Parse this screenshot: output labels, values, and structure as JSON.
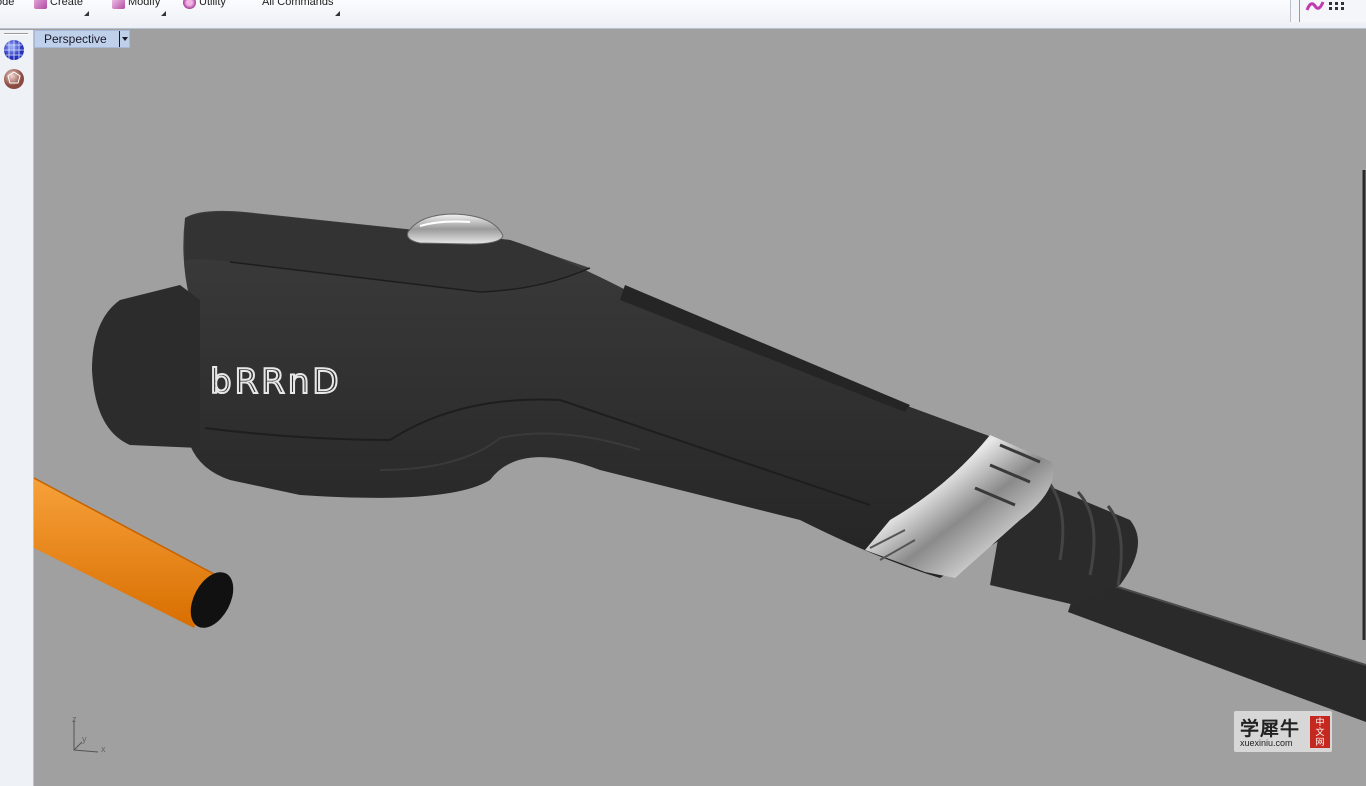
{
  "toolbar": {
    "items": [
      {
        "label": "ode"
      },
      {
        "label": "Create"
      },
      {
        "label": "Modify"
      },
      {
        "label": "Utility"
      },
      {
        "label": "All Commands"
      }
    ]
  },
  "viewport": {
    "title": "Perspective",
    "axes": {
      "z": "z",
      "y": "y",
      "x": "x"
    }
  },
  "model": {
    "brand_text": "bRRnD"
  },
  "colors": {
    "viewport_bg": "#a0a0a0",
    "handle_body": "#2f2f2f",
    "cable_orange": "#f08a12",
    "tab_bg": "#bfd0ea"
  },
  "watermark": {
    "chinese": "学犀牛",
    "url": "xuexiniu.com",
    "seal_chars": [
      "中",
      "文",
      "网"
    ]
  }
}
